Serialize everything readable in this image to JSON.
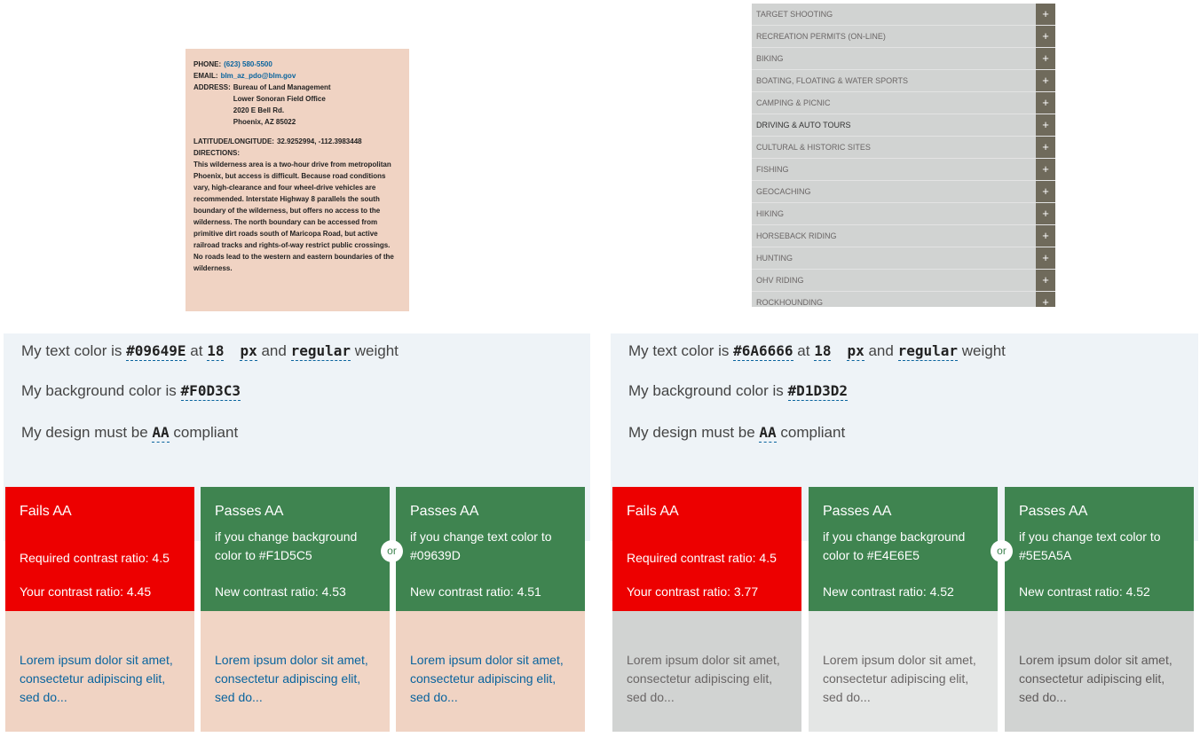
{
  "address_card": {
    "phone_label": "PHONE:",
    "phone": "(623) 580-5500",
    "email_label": "EMAIL:",
    "email": "blm_az_pdo@blm.gov",
    "address_label": "ADDRESS:",
    "address_lines": [
      "Bureau of Land Management",
      "Lower Sonoran Field Office",
      "2020 E Bell Rd.",
      "Phoenix, AZ 85022"
    ],
    "latlong_label": "LATITUDE/LONGITUDE:",
    "latlong": "32.9252994, -112.3983448",
    "directions_label": "DIRECTIONS:",
    "directions": "This wilderness area is a two-hour drive from metropolitan Phoenix, but access is difficult. Because road conditions vary, high-clearance and four wheel-drive vehicles are recommended. Interstate Highway 8 parallels the south boundary of the wilderness, but offers no access to the wilderness. The north boundary can be accessed from primitive dirt roads south of Maricopa Road, but active railroad tracks and rights-of-way restrict public crossings. No roads lead to the western and eastern boundaries of the wilderness."
  },
  "activities": {
    "plus": "+",
    "items": [
      "TARGET SHOOTING",
      "RECREATION PERMITS (ON-LINE)",
      "BIKING",
      "BOATING, FLOATING & WATER SPORTS",
      "CAMPING & PICNIC",
      "DRIVING & AUTO TOURS",
      "CULTURAL & HISTORIC SITES",
      "FISHING",
      "GEOCACHING",
      "HIKING",
      "HORSEBACK RIDING",
      "HUNTING",
      "OHV RIDING",
      "ROCKHOUNDING"
    ]
  },
  "checkers": [
    {
      "text_prefix": "My text color is",
      "text_color": "#09649E",
      "at": "at",
      "size": "18",
      "unit": "px",
      "and": "and",
      "weight": "regular",
      "weight_suffix": "weight",
      "bg_prefix": "My background color is",
      "bg_color": "#F0D3C3",
      "design_prefix": "My design must be",
      "level": "AA",
      "design_suffix": "compliant",
      "or": "or",
      "sample_text_color": "#09649e",
      "cards": [
        {
          "title": "Fails AA",
          "line1": "Required contrast ratio: 4.5",
          "line2": "Your contrast ratio: 4.45",
          "sample": "Lorem ipsum dolor sit amet, consectetur adipiscing elit, sed do...",
          "bg": "#f0d3c3"
        },
        {
          "title": "Passes AA",
          "sub": "if you change background color to #F1D5C5",
          "line2": "New contrast ratio: 4.53",
          "sample": "Lorem ipsum dolor sit amet, consectetur adipiscing elit, sed do...",
          "bg": "#f1d5c5"
        },
        {
          "title": "Passes AA",
          "sub": "if you change text color to #09639D",
          "line2": "New contrast ratio: 4.51",
          "sample": "Lorem ipsum dolor sit amet, consectetur adipiscing elit, sed do...",
          "bg": "#f0d3c3"
        }
      ]
    },
    {
      "text_prefix": "My text color is",
      "text_color": "#6A6666",
      "at": "at",
      "size": "18",
      "unit": "px",
      "and": "and",
      "weight": "regular",
      "weight_suffix": "weight",
      "bg_prefix": "My background color is",
      "bg_color": "#D1D3D2",
      "design_prefix": "My design must be",
      "level": "AA",
      "design_suffix": "compliant",
      "or": "or",
      "sample_text_color": "#6a6666",
      "cards": [
        {
          "title": "Fails AA",
          "line1": "Required contrast ratio: 4.5",
          "line2": "Your contrast ratio: 3.77",
          "sample": "Lorem ipsum dolor sit amet, consectetur adipiscing elit, sed do...",
          "bg": "#d1d3d2"
        },
        {
          "title": "Passes AA",
          "sub": "if you change background color to #E4E6E5",
          "line2": "New contrast ratio: 4.52",
          "sample": "Lorem ipsum dolor sit amet, consectetur adipiscing elit, sed do...",
          "bg": "#e4e6e5"
        },
        {
          "title": "Passes AA",
          "sub": "if you change text color to #5E5A5A",
          "line2": "New contrast ratio: 4.52",
          "sample": "Lorem ipsum dolor sit amet, consectetur adipiscing elit, sed do...",
          "bg": "#d1d3d2"
        }
      ]
    }
  ]
}
